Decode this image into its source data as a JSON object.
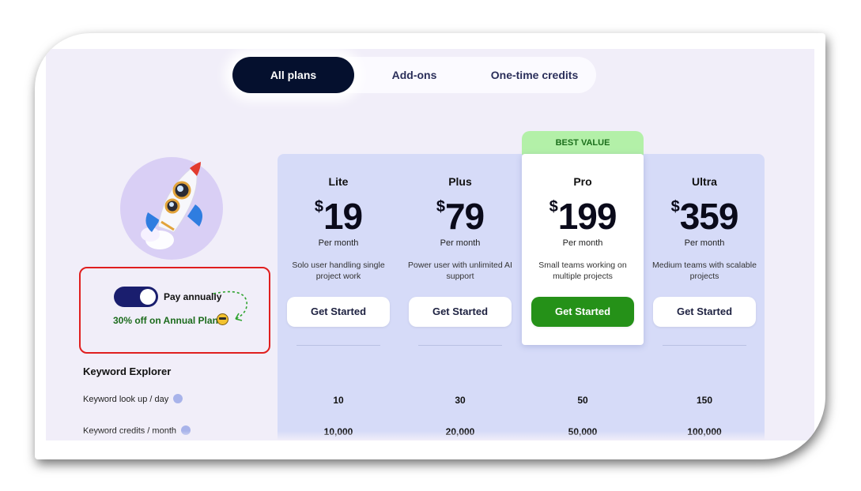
{
  "tabs": [
    {
      "label": "All plans"
    },
    {
      "label": "Add-ons"
    },
    {
      "label": "One-time credits"
    }
  ],
  "billing": {
    "toggle_label": "Pay annually",
    "toggle_on": true,
    "discount_text": "30% off on Annual Plan"
  },
  "best_value_badge": "BEST VALUE",
  "plans": [
    {
      "name": "Lite",
      "currency": "$",
      "price": "19",
      "period": "Per month",
      "description": "Solo user handling single project work",
      "cta": "Get Started",
      "keyword_lookup": "10",
      "keyword_credits": "10,000"
    },
    {
      "name": "Plus",
      "currency": "$",
      "price": "79",
      "period": "Per month",
      "description": "Power user with unlimited AI support",
      "cta": "Get Started",
      "keyword_lookup": "30",
      "keyword_credits": "20,000"
    },
    {
      "name": "Pro",
      "currency": "$",
      "price": "199",
      "period": "Per month",
      "description": "Small teams working on multiple projects",
      "cta": "Get Started",
      "keyword_lookup": "50",
      "keyword_credits": "50,000"
    },
    {
      "name": "Ultra",
      "currency": "$",
      "price": "359",
      "period": "Per month",
      "description": "Medium teams with scalable projects",
      "cta": "Get Started",
      "keyword_lookup": "150",
      "keyword_credits": "100,000"
    }
  ],
  "features": {
    "section_title": "Keyword Explorer",
    "rows": [
      {
        "label": "Keyword look up / day"
      },
      {
        "label": "Keyword credits / month"
      }
    ]
  },
  "colors": {
    "accent_dark": "#05102e",
    "cta_green": "#259118",
    "badge_green": "#b3f0a8",
    "highlight_red": "#e01f1f"
  }
}
